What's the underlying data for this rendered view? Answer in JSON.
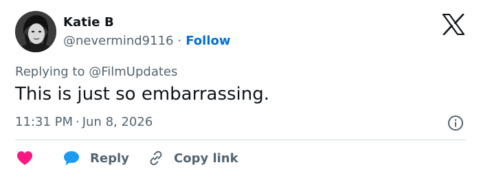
{
  "user": {
    "name": "Katie B",
    "handle": "@nevermind9116",
    "separator": "·",
    "follow_label": "Follow"
  },
  "tweet": {
    "reply_prefix": "Replying to",
    "reply_target": "@FilmUpdates",
    "text": "This is just so embarrassing.",
    "time": "11:31 PM",
    "separator": "·",
    "date": "Jun 8, 2026"
  },
  "actions": {
    "reply_label": "Reply",
    "copy_label": "Copy link"
  },
  "icons": {
    "logo": "x-logo-icon",
    "info": "info-icon",
    "like": "heart-icon",
    "reply": "speech-bubble-icon",
    "copy": "link-icon"
  },
  "colors": {
    "follow": "#006fd6",
    "like": "#f91880",
    "reply": "#1d9bf0",
    "secondary_text": "#536471",
    "primary_text": "#0f1419"
  }
}
